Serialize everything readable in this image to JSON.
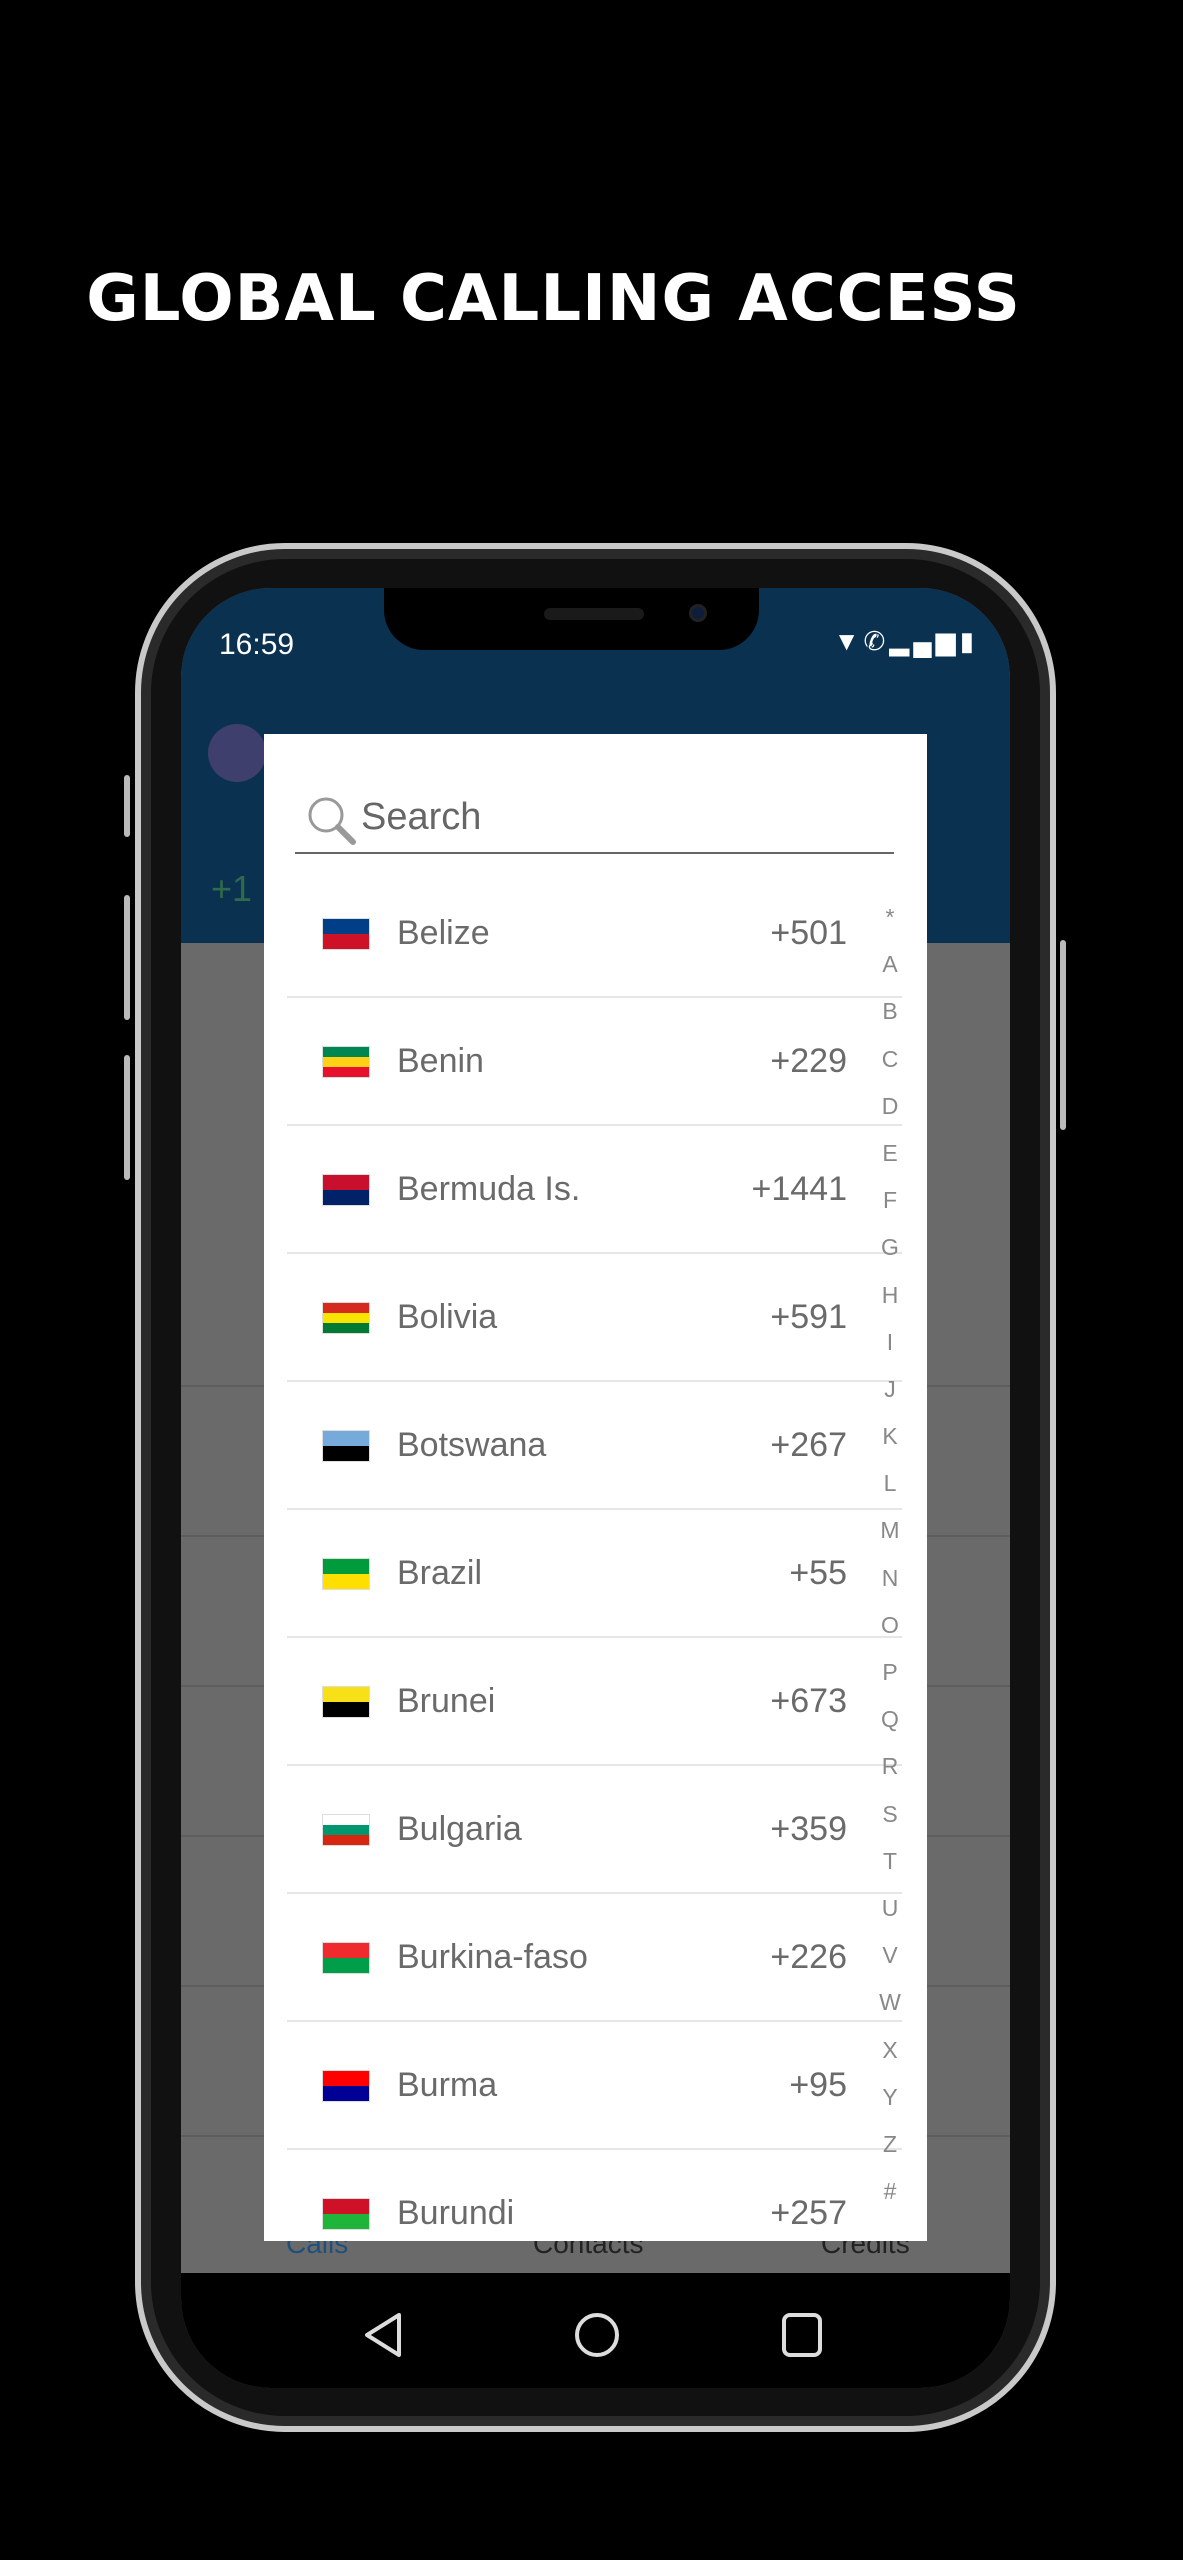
{
  "headline": "GLOBAL CALLING ACCESS",
  "status_bar": {
    "time": "16:59",
    "icons": [
      "wifi-icon",
      "wifi-calling-icon",
      "signal-icon",
      "battery-icon"
    ]
  },
  "background_app": {
    "number_prefix": "+1",
    "tabs": [
      "Calls",
      "Contacts",
      "Credits"
    ],
    "active_tab_color": "#1f4f7a"
  },
  "dialog": {
    "search_placeholder": "Search",
    "countries": [
      {
        "name": "Belize",
        "code": "+501",
        "flag": [
          "#003f87",
          "#ce1126"
        ]
      },
      {
        "name": "Benin",
        "code": "+229",
        "flag": [
          "#008751",
          "#fcd116",
          "#e8112d"
        ]
      },
      {
        "name": "Bermuda Is.",
        "code": "+1441",
        "flag": [
          "#c8102e",
          "#012169"
        ]
      },
      {
        "name": "Bolivia",
        "code": "+591",
        "flag": [
          "#d52b1e",
          "#f9e300",
          "#007934"
        ]
      },
      {
        "name": "Botswana",
        "code": "+267",
        "flag": [
          "#75aadb",
          "#000000"
        ]
      },
      {
        "name": "Brazil",
        "code": "+55",
        "flag": [
          "#009c3b",
          "#ffdf00"
        ]
      },
      {
        "name": "Brunei",
        "code": "+673",
        "flag": [
          "#f7e017",
          "#000000"
        ]
      },
      {
        "name": "Bulgaria",
        "code": "+359",
        "flag": [
          "#ffffff",
          "#00966e",
          "#d62612"
        ]
      },
      {
        "name": "Burkina-faso",
        "code": "+226",
        "flag": [
          "#ef2b2d",
          "#009e49"
        ]
      },
      {
        "name": "Burma",
        "code": "+95",
        "flag": [
          "#fe0000",
          "#000095"
        ]
      },
      {
        "name": "Burundi",
        "code": "+257",
        "flag": [
          "#ce1126",
          "#1eb53a"
        ]
      }
    ],
    "index": [
      "*",
      "A",
      "B",
      "C",
      "D",
      "E",
      "F",
      "G",
      "H",
      "I",
      "J",
      "K",
      "L",
      "M",
      "N",
      "O",
      "P",
      "Q",
      "R",
      "S",
      "T",
      "U",
      "V",
      "W",
      "X",
      "Y",
      "Z",
      "#"
    ]
  },
  "nav": [
    "back",
    "home",
    "recents"
  ]
}
